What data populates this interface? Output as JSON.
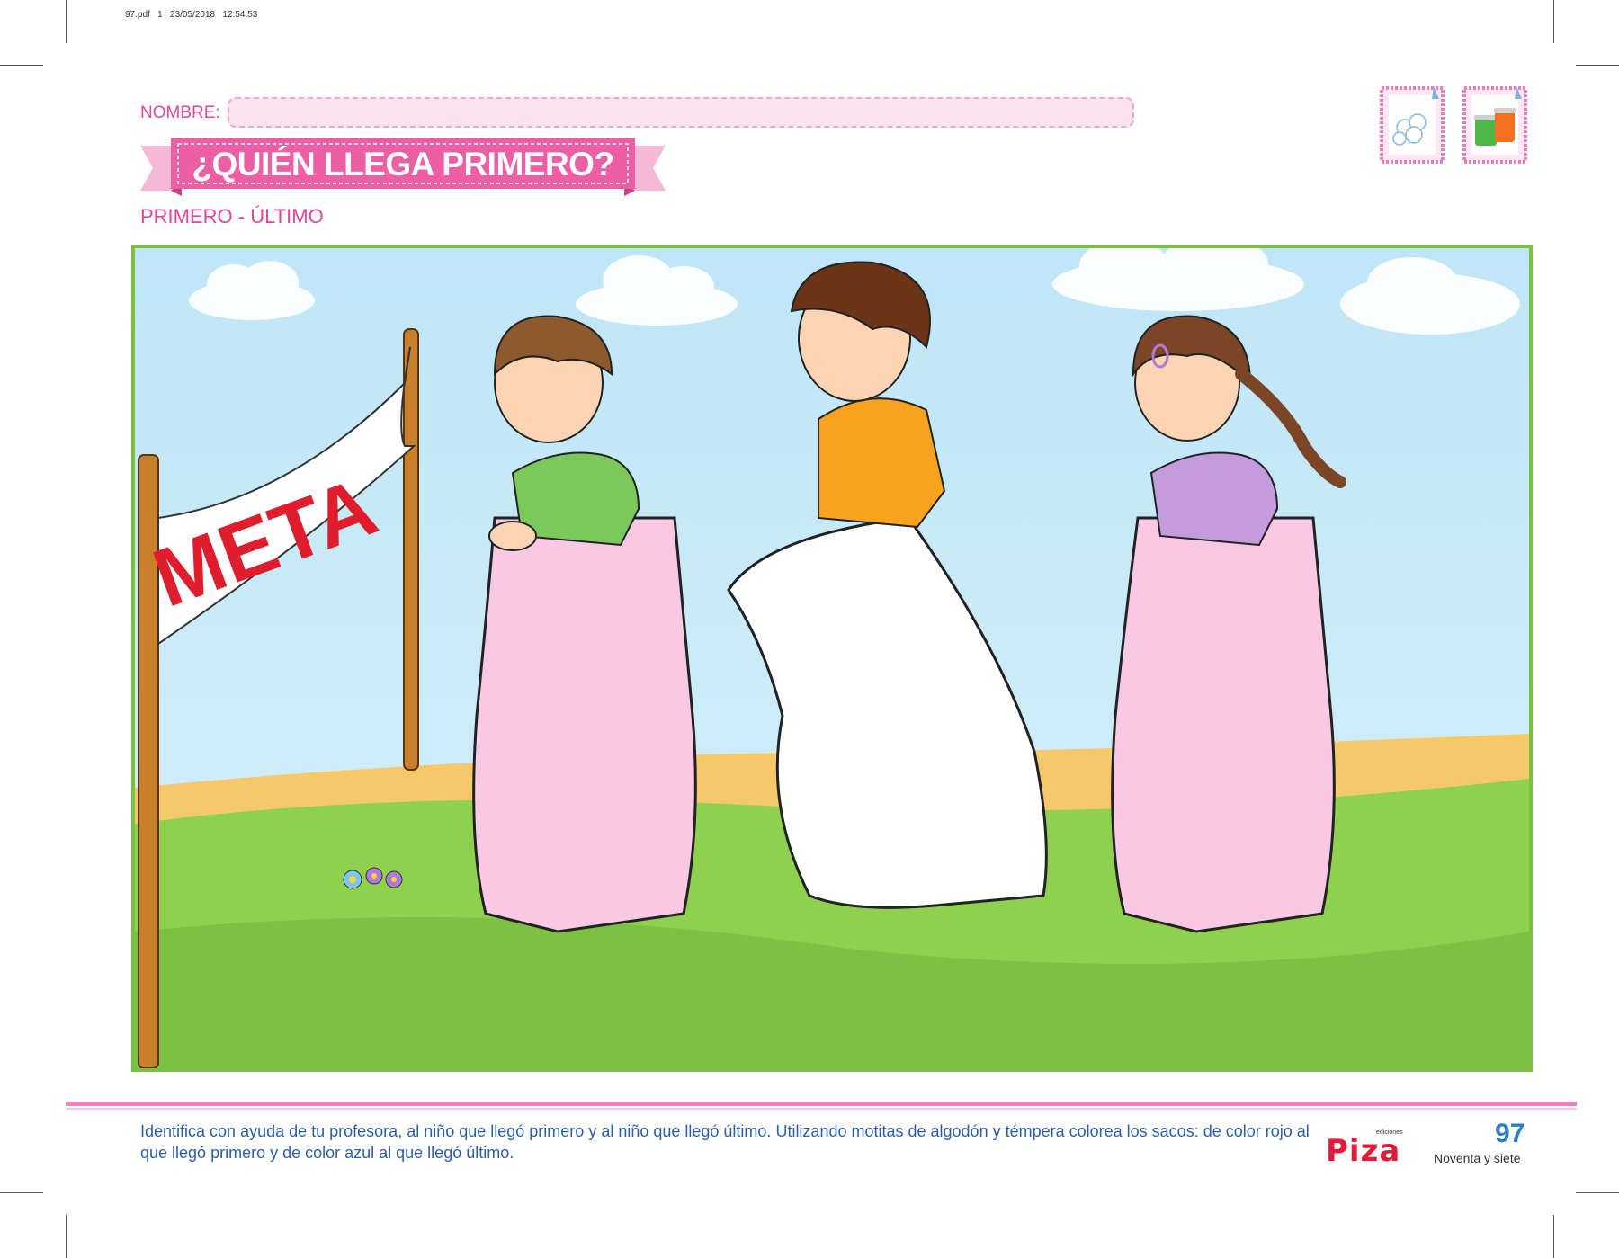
{
  "file_header": "97.pdf   1   23/05/2018   12:54:53",
  "name_label": "NOMBRE:",
  "title": "¿QUIÉN LLEGA PRIMERO?",
  "subtitle": "PRIMERO - ÚLTIMO",
  "materials": [
    {
      "icon": "cotton-balls-icon"
    },
    {
      "icon": "paint-jars-icon"
    }
  ],
  "scene": {
    "finish_banner_text": "META",
    "children": [
      {
        "shirt_color": "#7cc85a",
        "sack_color": "#f8c8e4"
      },
      {
        "shirt_color": "#f7a31e",
        "sack_color": "#ffffff"
      },
      {
        "shirt_color": "#c49bdc",
        "sack_color": "#f8c8e4"
      }
    ]
  },
  "instructions": "Identifica con ayuda de tu profesora, al niño que llegó primero y al niño que llegó último. Utilizando motitas de algodón y témpera colorea los sacos: de color rojo al que llegó primero y de color azul al que llegó último.",
  "publisher": {
    "name": "Piza",
    "tag": "ediciones"
  },
  "page_number": "97",
  "page_number_words": "Noventa y siete"
}
